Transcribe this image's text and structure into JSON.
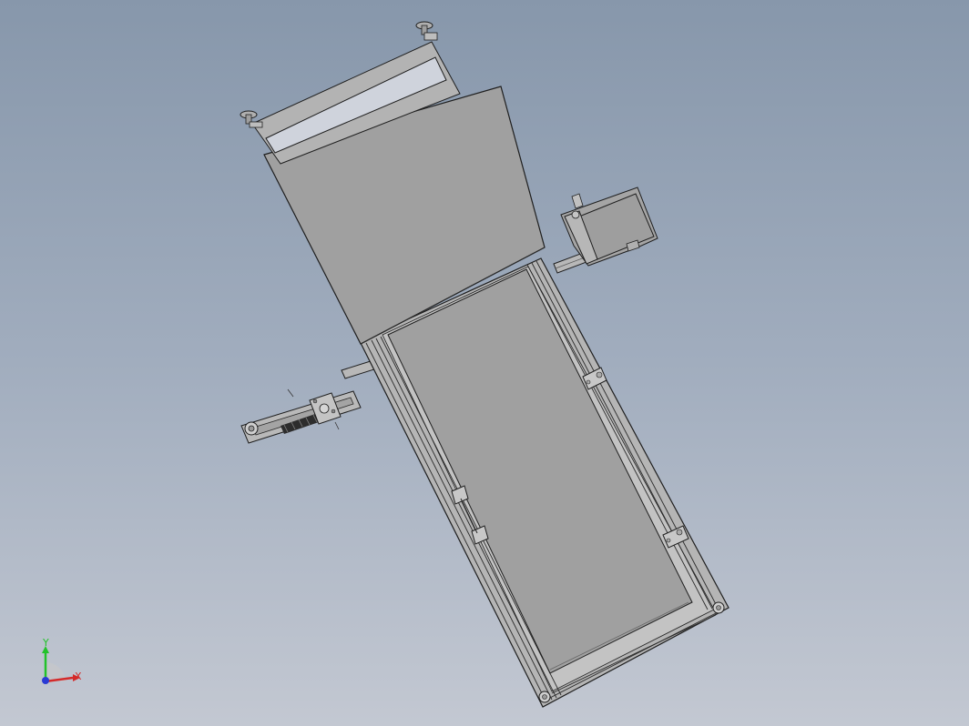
{
  "viewport": {
    "colors": {
      "background_top": "#8797ab",
      "background_bottom": "#c3c8d2",
      "part_face": "#a0a0a0",
      "part_edge": "#1e1e1e",
      "frame": "#b4b4b4"
    }
  },
  "triad": {
    "x_label": "X",
    "y_label": "Y",
    "x_color": "#d42a2a",
    "y_color": "#22c22a",
    "z_color": "#2a3ad4"
  }
}
